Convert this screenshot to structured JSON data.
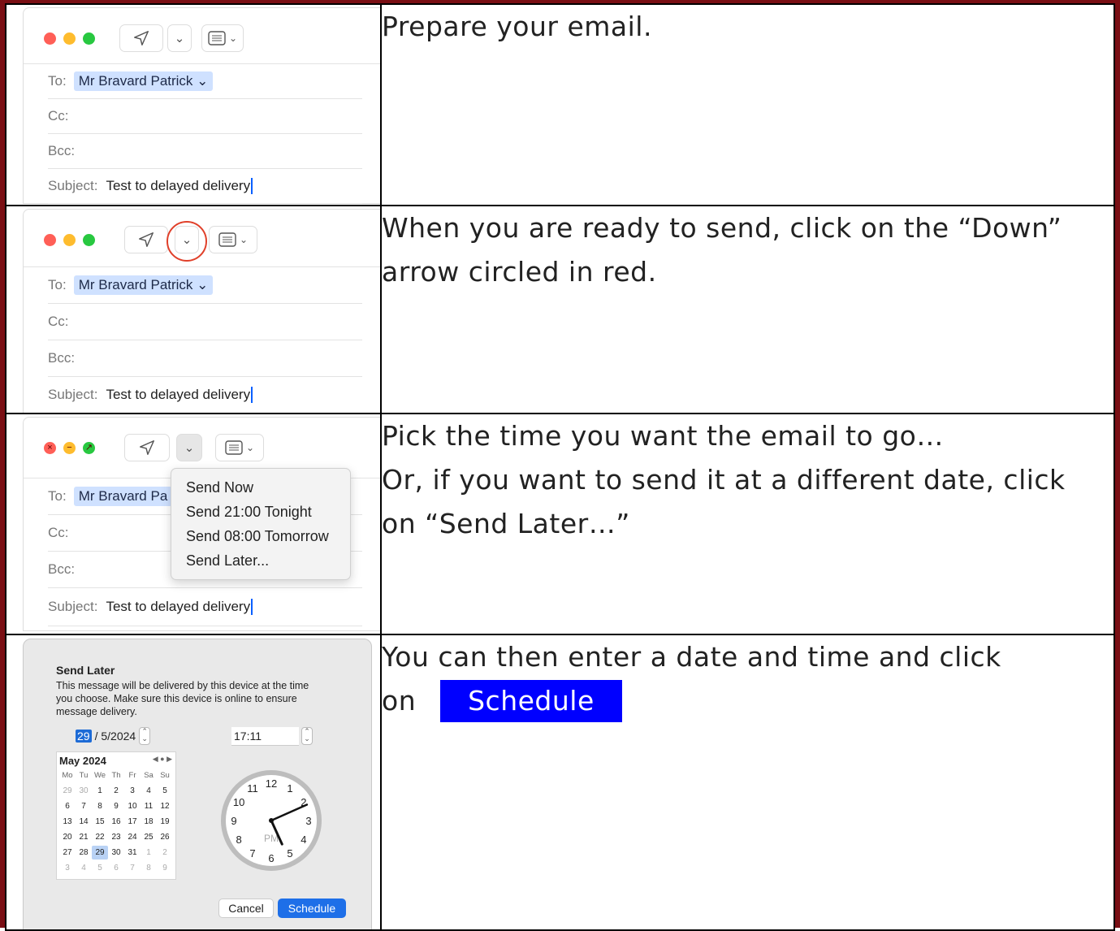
{
  "colors": {
    "border": "#7a0f14",
    "schedule_highlight": "#0000ff",
    "mail_chip": "#cfe1ff",
    "red_circle": "#e0402a",
    "dialog_primary": "#1e6fe8"
  },
  "icons": {
    "send": "paper-plane-icon",
    "dropdown": "chevron-down-icon",
    "format": "list-format-icon",
    "close": "close-icon"
  },
  "steps": [
    {
      "text": "Prepare your email."
    },
    {
      "text": "When you are ready to send, click on the “Down”\narrow circled in red."
    },
    {
      "text": "Pick the time you want the email to go…\nOr, if you want to send it at a different date, click\non “Send Later…”"
    },
    {
      "text_line1": "You can then enter a date and time and click",
      "text_on": "on",
      "button_label": "Schedule"
    }
  ],
  "mail": {
    "to_label": "To:",
    "recipient": "Mr Bravard Patrick",
    "recipient_short": "Mr Bravard Pa",
    "cc_label": "Cc:",
    "bcc_label": "Bcc:",
    "subject_label": "Subject:",
    "subject": "Test to delayed delivery"
  },
  "send_menu": [
    "Send Now",
    "Send 21:00 Tonight",
    "Send 08:00 Tomorrow",
    "Send Later..."
  ],
  "send_later": {
    "title": "Send Later",
    "message": "This message will be delivered by this device at the time you choose. Make sure this device is online to ensure message delivery.",
    "date_day": "29",
    "date_rest": "/ 5/2024",
    "time": "17:11",
    "calendar_title": "May 2024",
    "weekdays": [
      "Mo",
      "Tu",
      "We",
      "Th",
      "Fr",
      "Sa",
      "Su"
    ],
    "days": [
      "29",
      "30",
      "1",
      "2",
      "3",
      "4",
      "5",
      "6",
      "7",
      "8",
      "9",
      "10",
      "11",
      "12",
      "13",
      "14",
      "15",
      "16",
      "17",
      "18",
      "19",
      "20",
      "21",
      "22",
      "23",
      "24",
      "25",
      "26",
      "27",
      "28",
      "29",
      "30",
      "31",
      "1",
      "2",
      "3",
      "4",
      "5",
      "6",
      "7",
      "8",
      "9"
    ],
    "selected_day": "29",
    "clock_meridiem": "PM",
    "clock_hour": 17,
    "clock_minute": 11,
    "cancel_label": "Cancel",
    "schedule_label": "Schedule"
  }
}
